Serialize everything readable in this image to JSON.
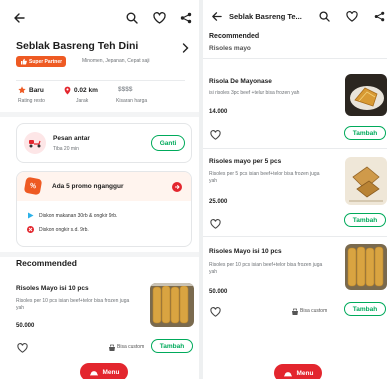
{
  "left": {
    "store_name": "Seblak Basreng Teh Dini",
    "badge_label": "Super Partner",
    "location": "Minomen, Jepanan, Cepat saji",
    "stats": [
      {
        "value": "Baru",
        "label": "Rating resto"
      },
      {
        "value": "0.02 km",
        "label": "Jarak"
      },
      {
        "value": "$$$$",
        "label": "Kisaran harga"
      }
    ],
    "delivery": {
      "title": "Pesan antar",
      "subtitle": "Tiba 20 min",
      "button": "Ganti"
    },
    "promo": {
      "title": "Ada 5 promo nganggur",
      "items": [
        "Diskon makanan 30rb & ongkir 9rb.",
        "Diskon ongkir s.d. 9rb."
      ]
    },
    "section_title": "Recommended",
    "item": {
      "name": "Risoles Mayo isi 10 pcs",
      "desc": "Risoles per 10 pcs isian beef+telor bisa frozen juga yah",
      "price": "50.000",
      "custom_label": "Bisa custom",
      "button": "Tambah"
    },
    "menu_label": "Menu"
  },
  "right": {
    "header_title": "Seblak Basreng Te...",
    "section_title": "Recommended",
    "prev_item_name": "Risoles mayo",
    "items": [
      {
        "name": "Risola De Mayonase",
        "desc": "isi risoles 3pc beef +telur bisa frozen yah",
        "price": "14.000",
        "button": "Tambah"
      },
      {
        "name": "Risoles mayo per 5 pcs",
        "desc": "Risoles per 5 pcs isian beef+telor bisa frozen juga yah",
        "price": "25.000",
        "button": "Tambah"
      },
      {
        "name": "Risoles Mayo isi 10 pcs",
        "desc": "Risoles per 10 pcs isian beef+telor bisa frozen juga yah",
        "price": "50.000",
        "custom_label": "Bisa custom",
        "button": "Tambah"
      }
    ],
    "menu_label": "Menu"
  },
  "colors": {
    "brand_green": "#00aa5b",
    "brand_red": "#e3262e",
    "badge_orange": "#ee5a23"
  }
}
